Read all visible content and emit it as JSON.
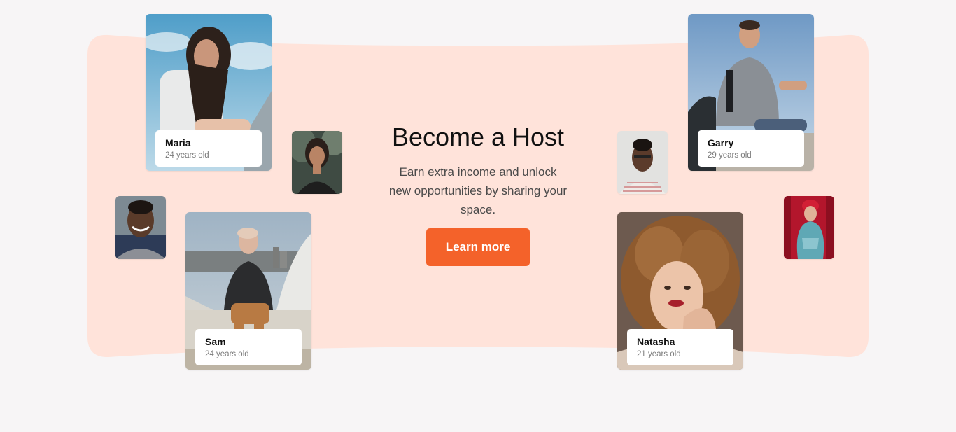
{
  "hero": {
    "title": "Become a Host",
    "description": "Earn extra income and unlock new opportunities by sharing your space.",
    "cta_label": "Learn more"
  },
  "hosts": [
    {
      "name": "Maria",
      "age": "24 years old"
    },
    {
      "name": "Sam",
      "age": "24 years old"
    },
    {
      "name": "Garry",
      "age": "29 years old"
    },
    {
      "name": "Natasha",
      "age": "21 years old"
    }
  ],
  "colors": {
    "page_background": "#f7f5f6",
    "banner_background": "#ffe3da",
    "cta_background": "#f4622a",
    "cta_text": "#ffffff"
  }
}
